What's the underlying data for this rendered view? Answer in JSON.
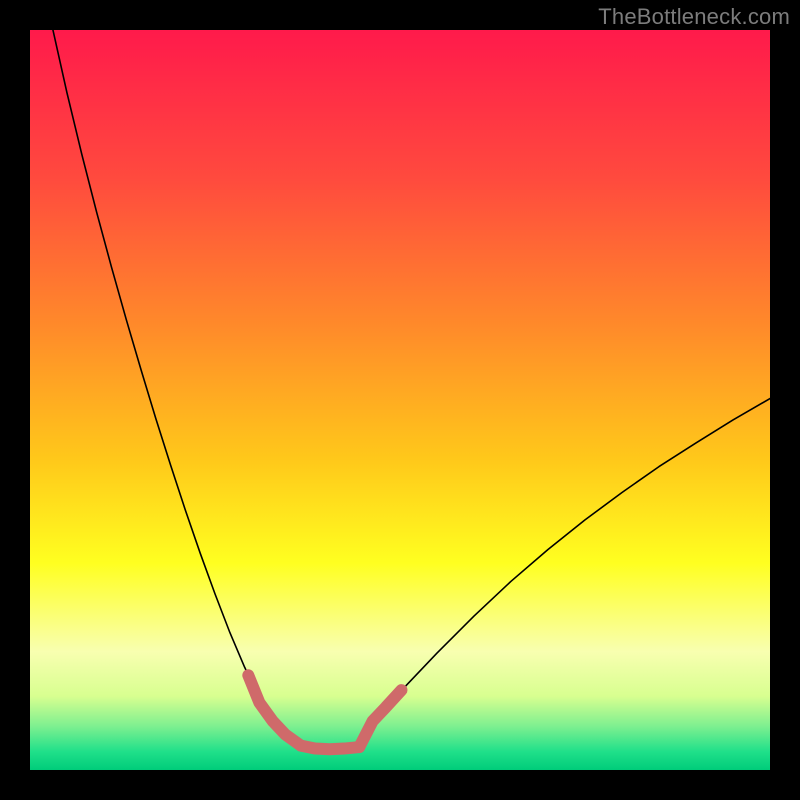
{
  "watermark": "TheBottleneck.com",
  "chart_data": {
    "type": "line",
    "title": "",
    "xlabel": "",
    "ylabel": "",
    "xlim": [
      0,
      100
    ],
    "ylim": [
      0,
      100
    ],
    "background_gradient_stops": [
      {
        "offset": 0.0,
        "color": "#ff1a4b"
      },
      {
        "offset": 0.2,
        "color": "#ff4a3e"
      },
      {
        "offset": 0.4,
        "color": "#ff8a2a"
      },
      {
        "offset": 0.58,
        "color": "#ffc81a"
      },
      {
        "offset": 0.72,
        "color": "#ffff20"
      },
      {
        "offset": 0.84,
        "color": "#f8ffb0"
      },
      {
        "offset": 0.9,
        "color": "#d8ff90"
      },
      {
        "offset": 0.94,
        "color": "#80f090"
      },
      {
        "offset": 0.975,
        "color": "#20e08a"
      },
      {
        "offset": 1.0,
        "color": "#00cc7a"
      }
    ],
    "series": [
      {
        "name": "left-branch",
        "x": [
          3.1,
          5,
          7,
          9,
          11,
          13,
          15,
          17,
          19,
          21,
          23,
          25,
          27,
          29,
          31,
          32.8
        ],
        "y": [
          100,
          91.5,
          83.2,
          75.4,
          68.0,
          60.9,
          54.1,
          47.5,
          41.2,
          35.1,
          29.3,
          23.8,
          18.6,
          13.9,
          9.7,
          6.6
        ],
        "color": "#000000",
        "width": 1.6
      },
      {
        "name": "right-branch",
        "x": [
          46.3,
          48,
          51,
          55,
          60,
          65,
          70,
          75,
          80,
          85,
          90,
          95,
          100
        ],
        "y": [
          6.6,
          8.4,
          11.6,
          15.8,
          20.8,
          25.5,
          29.8,
          33.8,
          37.5,
          41.0,
          44.2,
          47.3,
          50.2
        ],
        "color": "#000000",
        "width": 1.6
      },
      {
        "name": "highlight-left",
        "x": [
          29.5,
          31.0,
          32.8,
          34.5,
          36.6
        ],
        "y": [
          12.8,
          9.1,
          6.6,
          4.8,
          3.3
        ],
        "color": "#cf6a6a",
        "width": 12
      },
      {
        "name": "highlight-bottom",
        "x": [
          36.6,
          38.5,
          40.5,
          42.5,
          44.5
        ],
        "y": [
          3.3,
          2.9,
          2.8,
          2.9,
          3.1
        ],
        "color": "#cf6a6a",
        "width": 12
      },
      {
        "name": "highlight-right",
        "x": [
          44.5,
          46.3,
          48.0,
          50.2
        ],
        "y": [
          3.1,
          6.6,
          8.4,
          10.8
        ],
        "color": "#cf6a6a",
        "width": 12
      }
    ]
  }
}
